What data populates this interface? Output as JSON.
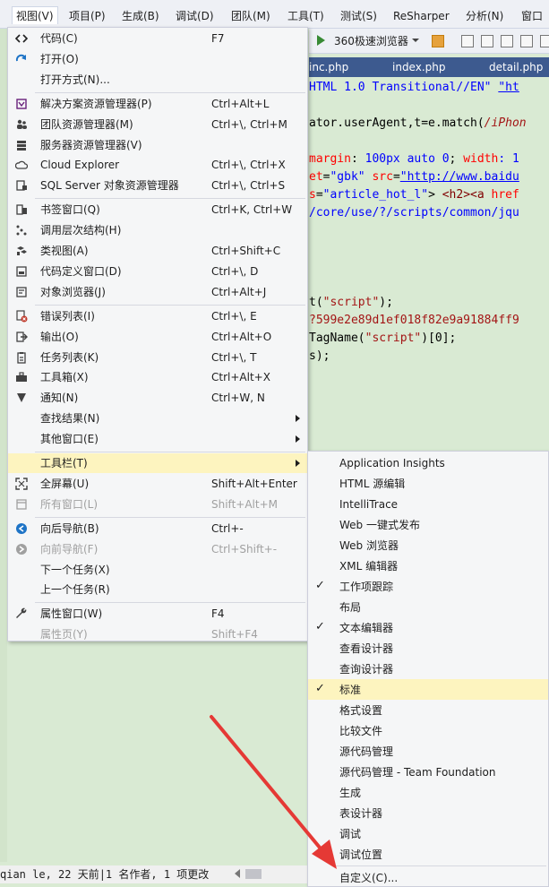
{
  "menubar": {
    "items": [
      "视图(V)",
      "项目(P)",
      "生成(B)",
      "调试(D)",
      "团队(M)",
      "工具(T)",
      "测试(S)",
      "ReSharper",
      "分析(N)",
      "窗口"
    ],
    "active": "视图(V)"
  },
  "toolbar": {
    "browser_label": "360极速浏览器"
  },
  "tabs": [
    "inc.php",
    "index.php",
    "detail.php"
  ],
  "editor": {
    "lines": [
      {
        "parts": [
          {
            "t": "HTML 1.0 Transitional//EN\" ",
            "c": "kw"
          },
          {
            "t": "\"ht",
            "c": "lnk"
          }
        ]
      },
      {
        "parts": [
          {
            "t": "",
            "c": "plain"
          }
        ]
      },
      {
        "parts": [
          {
            "t": "ator.userAgent,t=e.match(",
            "c": "plain"
          },
          {
            "t": "/iPhon",
            "c": "it"
          }
        ]
      },
      {
        "parts": [
          {
            "t": "",
            "c": "plain"
          }
        ]
      },
      {
        "parts": [
          {
            "t": "margin",
            "c": "attr"
          },
          {
            "t": ": ",
            "c": "plain"
          },
          {
            "t": "100px auto 0",
            "c": "kw"
          },
          {
            "t": "; ",
            "c": "plain"
          },
          {
            "t": "width",
            "c": "attr"
          },
          {
            "t": ": 1",
            "c": "kw"
          }
        ]
      },
      {
        "parts": [
          {
            "t": "et",
            "c": "attr"
          },
          {
            "t": "=",
            "c": "plain"
          },
          {
            "t": "\"gbk\"",
            "c": "kw"
          },
          {
            "t": " ",
            "c": "plain"
          },
          {
            "t": "src",
            "c": "attr"
          },
          {
            "t": "=",
            "c": "plain"
          },
          {
            "t": "\"http://www.baidu",
            "c": "lnk"
          }
        ]
      },
      {
        "parts": [
          {
            "t": "s",
            "c": "attr"
          },
          {
            "t": "=",
            "c": "plain"
          },
          {
            "t": "\"article_hot_l\"",
            "c": "kw"
          },
          {
            "t": "> ",
            "c": "plain"
          },
          {
            "t": "<h2><a ",
            "c": "tag"
          },
          {
            "t": "href",
            "c": "attr"
          }
        ]
      },
      {
        "parts": [
          {
            "t": "/core/use/?/scripts/common/jqu",
            "c": "kw"
          }
        ]
      },
      {
        "parts": [
          {
            "t": "",
            "c": "plain"
          }
        ]
      },
      {
        "parts": [
          {
            "t": "",
            "c": "plain"
          }
        ]
      },
      {
        "parts": [
          {
            "t": "",
            "c": "plain"
          }
        ]
      },
      {
        "parts": [
          {
            "t": "",
            "c": "plain"
          }
        ]
      },
      {
        "parts": [
          {
            "t": "t(",
            "c": "plain"
          },
          {
            "t": "\"script\"",
            "c": "str"
          },
          {
            "t": ");",
            "c": "plain"
          }
        ]
      },
      {
        "parts": [
          {
            "t": "?599e2e89d1ef018f82e9a91884ff9",
            "c": "str"
          }
        ]
      },
      {
        "parts": [
          {
            "t": "TagName(",
            "c": "plain"
          },
          {
            "t": "\"script\"",
            "c": "str"
          },
          {
            "t": ")[0];",
            "c": "plain"
          }
        ]
      },
      {
        "parts": [
          {
            "t": "s);",
            "c": "plain"
          }
        ]
      }
    ]
  },
  "view_menu": {
    "items": [
      {
        "label": "代码(C)",
        "shortcut": "F7",
        "icon": "code-icon",
        "color": "#1e1e1e"
      },
      {
        "label": "打开(O)",
        "shortcut": "",
        "icon": "open-arrow-icon",
        "color": "#1e74c6"
      },
      {
        "label": "打开方式(N)...",
        "shortcut": "",
        "icon": "",
        "color": ""
      },
      {
        "sep": true
      },
      {
        "label": "解决方案资源管理器(P)",
        "shortcut": "Ctrl+Alt+L",
        "icon": "solution-explorer-icon",
        "color": "#68217a"
      },
      {
        "label": "团队资源管理器(M)",
        "shortcut": "Ctrl+\\, Ctrl+M",
        "icon": "team-explorer-icon",
        "color": "#424242"
      },
      {
        "label": "服务器资源管理器(V)",
        "shortcut": "",
        "icon": "server-explorer-icon",
        "color": "#424242"
      },
      {
        "label": "Cloud Explorer",
        "shortcut": "Ctrl+\\, Ctrl+X",
        "icon": "cloud-icon",
        "color": "#424242"
      },
      {
        "label": "SQL Server 对象资源管理器",
        "shortcut": "Ctrl+\\, Ctrl+S",
        "icon": "sql-server-icon",
        "color": "#424242"
      },
      {
        "sep": true
      },
      {
        "label": "书签窗口(Q)",
        "shortcut": "Ctrl+K, Ctrl+W",
        "icon": "bookmark-icon",
        "color": "#424242"
      },
      {
        "label": "调用层次结构(H)",
        "shortcut": "",
        "icon": "call-hierarchy-icon",
        "color": "#424242"
      },
      {
        "label": "类视图(A)",
        "shortcut": "Ctrl+Shift+C",
        "icon": "class-view-icon",
        "color": "#424242"
      },
      {
        "label": "代码定义窗口(D)",
        "shortcut": "Ctrl+\\, D",
        "icon": "code-definition-icon",
        "color": "#424242"
      },
      {
        "label": "对象浏览器(J)",
        "shortcut": "Ctrl+Alt+J",
        "icon": "object-browser-icon",
        "color": "#424242"
      },
      {
        "sep": true
      },
      {
        "label": "错误列表(I)",
        "shortcut": "Ctrl+\\, E",
        "icon": "error-list-icon",
        "color": "#c0392b"
      },
      {
        "label": "输出(O)",
        "shortcut": "Ctrl+Alt+O",
        "icon": "output-icon",
        "color": "#424242"
      },
      {
        "label": "任务列表(K)",
        "shortcut": "Ctrl+\\, T",
        "icon": "task-list-icon",
        "color": "#424242"
      },
      {
        "label": "工具箱(X)",
        "shortcut": "Ctrl+Alt+X",
        "icon": "toolbox-icon",
        "color": "#424242"
      },
      {
        "label": "通知(N)",
        "shortcut": "Ctrl+W, N",
        "icon": "notification-icon",
        "color": "#424242"
      },
      {
        "label": "查找结果(N)",
        "shortcut": "",
        "icon": "",
        "color": "",
        "submenu": true
      },
      {
        "label": "其他窗口(E)",
        "shortcut": "",
        "icon": "",
        "color": "",
        "submenu": true
      },
      {
        "sep": true
      },
      {
        "label": "工具栏(T)",
        "shortcut": "",
        "icon": "",
        "color": "",
        "submenu": true,
        "highlight": true
      },
      {
        "label": "全屏幕(U)",
        "shortcut": "Shift+Alt+Enter",
        "icon": "fullscreen-icon",
        "color": "#424242"
      },
      {
        "label": "所有窗口(L)",
        "shortcut": "Shift+Alt+M",
        "icon": "all-windows-icon",
        "color": "#a0a0a0",
        "disabled": true
      },
      {
        "sep": true
      },
      {
        "label": "向后导航(B)",
        "shortcut": "Ctrl+-",
        "icon": "navigate-back-icon",
        "color": "#1e74c6"
      },
      {
        "label": "向前导航(F)",
        "shortcut": "Ctrl+Shift+-",
        "icon": "navigate-forward-icon",
        "color": "#a0a0a0",
        "disabled": true
      },
      {
        "label": "下一个任务(X)",
        "shortcut": "",
        "icon": "",
        "color": ""
      },
      {
        "label": "上一个任务(R)",
        "shortcut": "",
        "icon": "",
        "color": ""
      },
      {
        "sep": true
      },
      {
        "label": "属性窗口(W)",
        "shortcut": "F4",
        "icon": "wrench-icon",
        "color": "#424242"
      },
      {
        "label": "属性页(Y)",
        "shortcut": "Shift+F4",
        "icon": "",
        "color": "",
        "disabled": true
      }
    ]
  },
  "toolbar_submenu": {
    "items": [
      {
        "label": "Application Insights",
        "checked": false
      },
      {
        "label": "HTML 源编辑",
        "checked": false
      },
      {
        "label": "IntelliTrace",
        "checked": false
      },
      {
        "label": "Web 一键式发布",
        "checked": false
      },
      {
        "label": "Web 浏览器",
        "checked": false
      },
      {
        "label": "XML 编辑器",
        "checked": false
      },
      {
        "label": "工作项跟踪",
        "checked": true
      },
      {
        "label": "布局",
        "checked": false
      },
      {
        "label": "文本编辑器",
        "checked": true
      },
      {
        "label": "查看设计器",
        "checked": false
      },
      {
        "label": "查询设计器",
        "checked": false
      },
      {
        "label": "标准",
        "checked": true,
        "highlight": true
      },
      {
        "label": "格式设置",
        "checked": false
      },
      {
        "label": "比较文件",
        "checked": false
      },
      {
        "label": "源代码管理",
        "checked": false
      },
      {
        "label": "源代码管理 - Team Foundation",
        "checked": false
      },
      {
        "label": "生成",
        "checked": false
      },
      {
        "label": "表设计器",
        "checked": false
      },
      {
        "label": "调试",
        "checked": false
      },
      {
        "label": "调试位置",
        "checked": false
      },
      {
        "sep": true
      },
      {
        "label": "自定义(C)...",
        "checked": false
      }
    ],
    "check_glyph": "✓"
  },
  "status": {
    "text": "qian le, 22 天前|1 名作者, 1 项更改"
  },
  "colors": {
    "editor_bg": "#d9ead3",
    "menu_bg": "#f5f6f7",
    "highlight": "#fdf4bf",
    "tab_bar": "#3d5a8f",
    "annotation_arrow": "#e53935"
  }
}
